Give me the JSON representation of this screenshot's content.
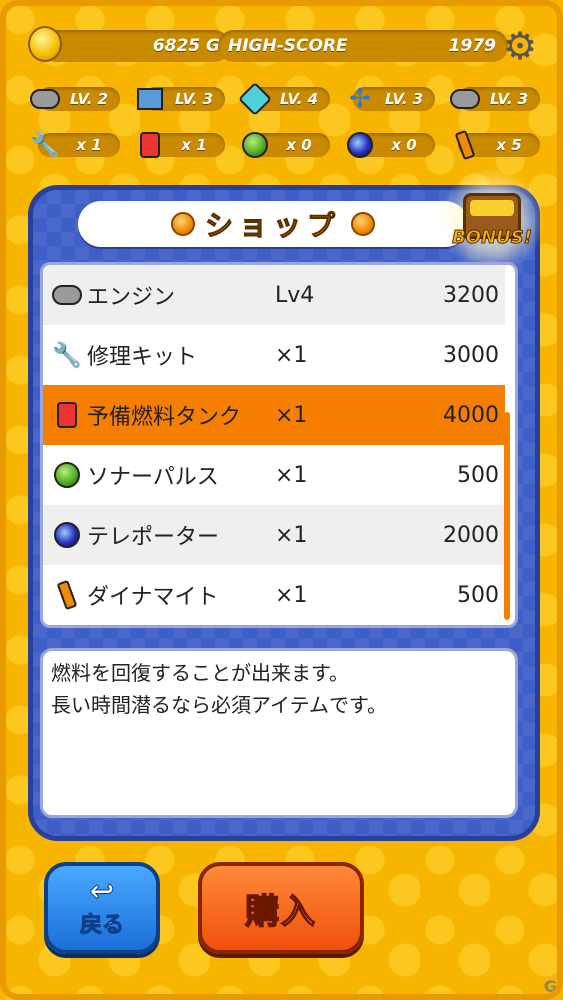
{
  "status": {
    "gold": "6825 G",
    "highscore_label": "HIGH-SCORE",
    "highscore_value": "1979"
  },
  "upgrades": [
    {
      "icon": "engine-icon",
      "label": "LV. 2"
    },
    {
      "icon": "hull-box-icon",
      "label": "LV. 3"
    },
    {
      "icon": "crystal-icon",
      "label": "LV. 4"
    },
    {
      "icon": "propeller-icon",
      "label": "LV. 3"
    },
    {
      "icon": "drill-icon",
      "label": "LV. 3"
    }
  ],
  "inventory": [
    {
      "icon": "wrench-icon",
      "label": "x 1"
    },
    {
      "icon": "fuel-tank-icon",
      "label": "x 1"
    },
    {
      "icon": "sonar-icon",
      "label": "x 0"
    },
    {
      "icon": "teleporter-icon",
      "label": "x 0"
    },
    {
      "icon": "dynamite-icon",
      "label": "x 5"
    }
  ],
  "shop": {
    "title": "ショップ",
    "bonus_label": "BONUS!",
    "items": [
      {
        "icon": "engine-icon",
        "name": "エンジン",
        "qty": "Lv4",
        "price": "3200"
      },
      {
        "icon": "wrench-icon",
        "name": "修理キット",
        "qty": "×1",
        "price": "3000"
      },
      {
        "icon": "fuel-tank-icon",
        "name": "予備燃料タンク",
        "qty": "×1",
        "price": "4000"
      },
      {
        "icon": "sonar-icon",
        "name": "ソナーパルス",
        "qty": "×1",
        "price": "500"
      },
      {
        "icon": "teleporter-icon",
        "name": "テレポーター",
        "qty": "×1",
        "price": "2000"
      },
      {
        "icon": "dynamite-icon",
        "name": "ダイナマイト",
        "qty": "×1",
        "price": "500"
      }
    ],
    "selected_index": 2,
    "description_line1": "燃料を回復することが出来ます。",
    "description_line2": "長い時間潜るなら必須アイテムです。"
  },
  "buttons": {
    "back_label": "戻る",
    "buy_label": "購入"
  },
  "watermark": "G"
}
